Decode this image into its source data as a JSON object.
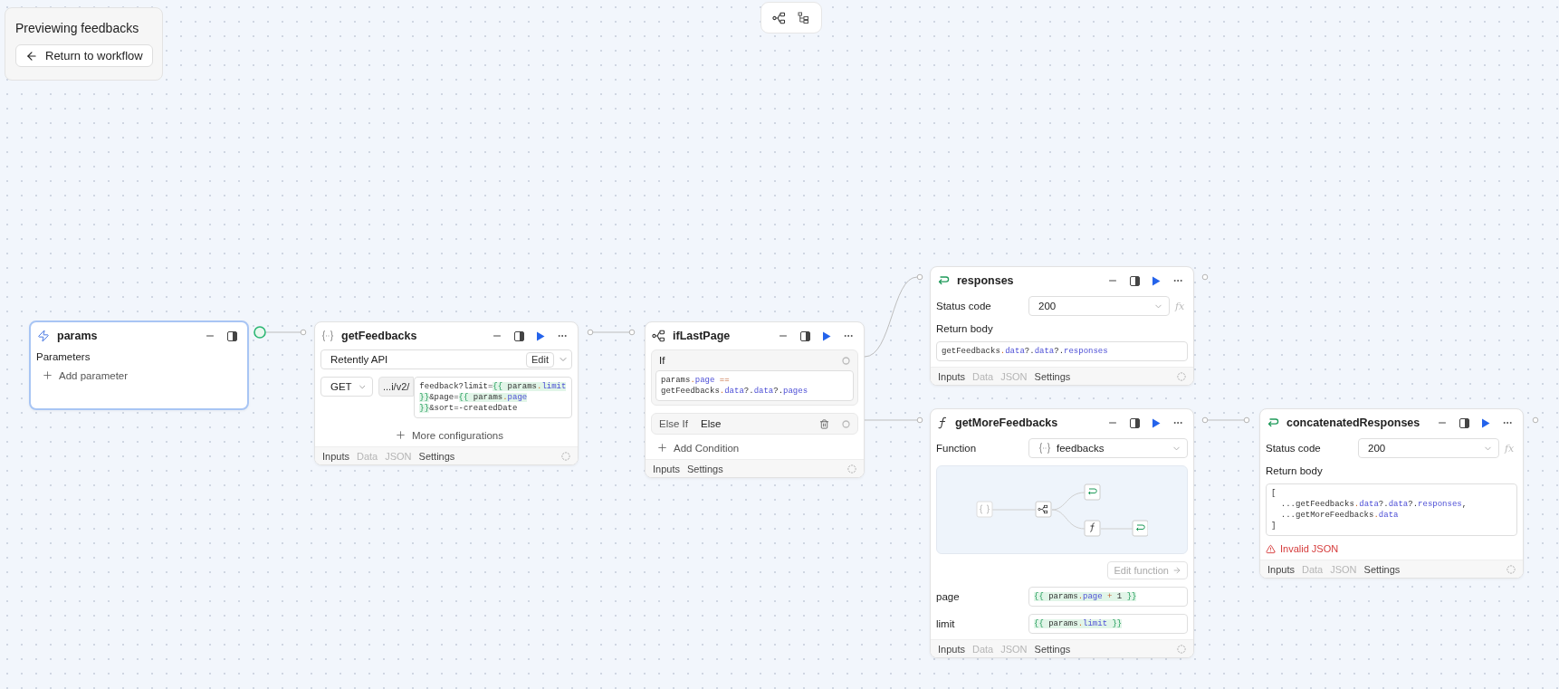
{
  "preview": {
    "title": "Previewing feedbacks",
    "return_button": "Return to workflow"
  },
  "nodes": [
    {
      "kind": "trigger",
      "title": "params",
      "selected": true,
      "runnable": false,
      "section_label": "Parameters",
      "add_label": "Add parameter"
    },
    {
      "kind": "resource",
      "title": "getFeedbacks",
      "selected": false,
      "runnable": true,
      "resource": "Retently API",
      "edit_label": "Edit",
      "method": "GET",
      "url_prefix": "...i/v2/",
      "url_code": [
        [
          {
            "text": "feedback?limit=",
            "kind": "plain"
          },
          {
            "text": "{{",
            "kind": "tpl-brace"
          },
          {
            "text": " params",
            "kind": "tpl-plain"
          },
          {
            "text": ".",
            "kind": "tpl-dot"
          },
          {
            "text": "limit",
            "kind": "tpl-prop"
          }
        ],
        [
          {
            "text": "}}",
            "kind": "tpl-brace"
          },
          {
            "text": "&page=",
            "kind": "plain"
          },
          {
            "text": "{{",
            "kind": "tpl-brace"
          },
          {
            "text": " params",
            "kind": "tpl-plain"
          },
          {
            "text": ".",
            "kind": "tpl-dot"
          },
          {
            "text": "page",
            "kind": "tpl-prop"
          }
        ],
        [
          {
            "text": "}}",
            "kind": "tpl-brace"
          },
          {
            "text": "&sort=-createdDate",
            "kind": "plain"
          }
        ]
      ],
      "more_label": "More configurations",
      "footer_tabs": [
        {
          "label": "Inputs",
          "disabled": false
        },
        {
          "label": "Data",
          "disabled": true
        },
        {
          "label": "JSON",
          "disabled": true
        },
        {
          "label": "Settings",
          "disabled": false
        }
      ]
    },
    {
      "kind": "branch",
      "title": "ifLastPage",
      "selected": false,
      "runnable": true,
      "conditions": [
        {
          "label": "If",
          "code": [
            [
              {
                "text": "params",
                "kind": "plain"
              },
              {
                "text": ".",
                "kind": "dot"
              },
              {
                "text": "page",
                "kind": "prop"
              },
              {
                "text": " ==",
                "kind": "op"
              }
            ],
            [
              {
                "text": "getFeedbacks",
                "kind": "plain"
              },
              {
                "text": ".",
                "kind": "dot"
              },
              {
                "text": "data",
                "kind": "prop"
              },
              {
                "text": "?.",
                "kind": "plain"
              },
              {
                "text": "data",
                "kind": "prop"
              },
              {
                "text": "?.",
                "kind": "plain"
              },
              {
                "text": "pages",
                "kind": "prop"
              }
            ]
          ]
        }
      ],
      "else_branch": {
        "label": "Else If",
        "value": "Else"
      },
      "add_label": "Add Condition",
      "footer_tabs": [
        {
          "label": "Inputs",
          "disabled": false
        },
        {
          "label": "Settings",
          "disabled": false
        }
      ]
    },
    {
      "kind": "response",
      "title": "responses",
      "selected": false,
      "runnable": true,
      "status_label": "Status code",
      "status_value": "200",
      "formula_mark": "fx",
      "body_label": "Return body",
      "body_code": [
        [
          {
            "text": "getFeedbacks",
            "kind": "plain"
          },
          {
            "text": ".",
            "kind": "dot"
          },
          {
            "text": "data",
            "kind": "prop"
          },
          {
            "text": "?.",
            "kind": "plain"
          },
          {
            "text": "data",
            "kind": "prop"
          },
          {
            "text": "?.",
            "kind": "plain"
          },
          {
            "text": "responses",
            "kind": "prop"
          }
        ]
      ],
      "footer_tabs": [
        {
          "label": "Inputs",
          "disabled": false
        },
        {
          "label": "Data",
          "disabled": true
        },
        {
          "label": "JSON",
          "disabled": true
        },
        {
          "label": "Settings",
          "disabled": false
        }
      ]
    },
    {
      "kind": "function",
      "title": "getMoreFeedbacks",
      "selected": false,
      "runnable": true,
      "function_label": "Function",
      "function_value": "feedbacks",
      "edit_label": "Edit function",
      "arguments": [
        {
          "name": "page",
          "code": [
            [
              {
                "text": "{{",
                "kind": "tpl-brace"
              },
              {
                "text": " params",
                "kind": "tpl-plain"
              },
              {
                "text": ".",
                "kind": "tpl-dot"
              },
              {
                "text": "page",
                "kind": "tpl-prop"
              },
              {
                "text": " +",
                "kind": "tpl-op"
              },
              {
                "text": " 1 ",
                "kind": "tpl-plain"
              },
              {
                "text": "}}",
                "kind": "tpl-brace"
              }
            ]
          ]
        },
        {
          "name": "limit",
          "code": [
            [
              {
                "text": "{{",
                "kind": "tpl-brace"
              },
              {
                "text": " params",
                "kind": "tpl-plain"
              },
              {
                "text": ".",
                "kind": "tpl-dot"
              },
              {
                "text": "limit",
                "kind": "tpl-prop"
              },
              {
                "text": " }}",
                "kind": "tpl-brace"
              }
            ]
          ]
        }
      ],
      "footer_tabs": [
        {
          "label": "Inputs",
          "disabled": false
        },
        {
          "label": "Data",
          "disabled": true
        },
        {
          "label": "JSON",
          "disabled": true
        },
        {
          "label": "Settings",
          "disabled": false
        }
      ]
    },
    {
      "kind": "response",
      "title": "concatenatedResponses",
      "selected": false,
      "runnable": true,
      "status_label": "Status code",
      "status_value": "200",
      "formula_mark": "fx",
      "body_label": "Return body",
      "body_code": [
        [
          {
            "text": "[",
            "kind": "plain"
          }
        ],
        [
          {
            "text": "  ...getFeedbacks",
            "kind": "plain"
          },
          {
            "text": ".",
            "kind": "dot"
          },
          {
            "text": "data",
            "kind": "prop"
          },
          {
            "text": "?.",
            "kind": "plain"
          },
          {
            "text": "data",
            "kind": "prop"
          },
          {
            "text": "?.",
            "kind": "plain"
          },
          {
            "text": "responses",
            "kind": "prop"
          },
          {
            "text": ",",
            "kind": "plain"
          }
        ],
        [
          {
            "text": "  ...getMoreFeedbacks",
            "kind": "plain"
          },
          {
            "text": ".",
            "kind": "dot"
          },
          {
            "text": "data",
            "kind": "prop"
          }
        ],
        [
          {
            "text": "]",
            "kind": "plain"
          }
        ]
      ],
      "error": "Invalid JSON",
      "footer_tabs": [
        {
          "label": "Inputs",
          "disabled": false
        },
        {
          "label": "Data",
          "disabled": true
        },
        {
          "label": "JSON",
          "disabled": true
        },
        {
          "label": "Settings",
          "disabled": false
        }
      ]
    }
  ]
}
